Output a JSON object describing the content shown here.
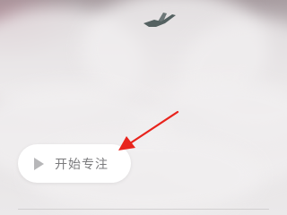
{
  "focus_button": {
    "label": "开始专注",
    "icon": "play-icon"
  },
  "annotation": {
    "arrow_color": "#e8231c",
    "icon": "arrow-icon"
  },
  "background": {
    "description_color_top": "#a99ea2",
    "description_color_bottom": "#ebe9ea"
  }
}
